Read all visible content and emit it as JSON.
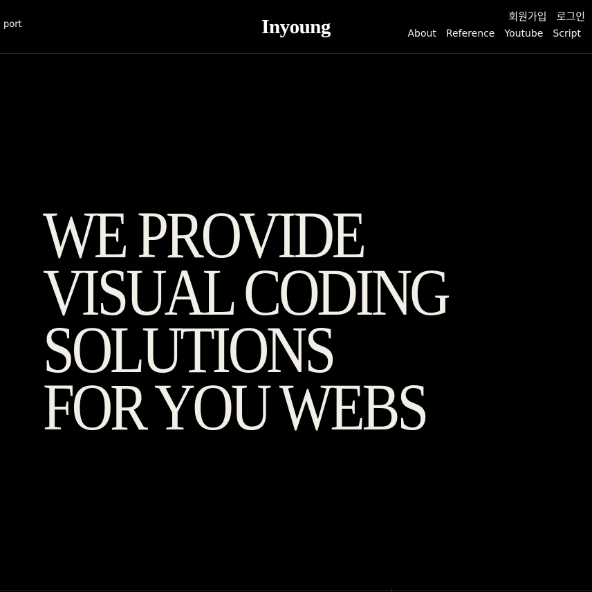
{
  "header": {
    "left_link": "port",
    "logo": "Inyoung",
    "auth": {
      "signup": "회원가입",
      "login": "로그인"
    },
    "nav": {
      "about": "About",
      "reference": "Reference",
      "youtube": "Youtube",
      "script": "Script"
    }
  },
  "hero": {
    "lines": [
      "WE PROVIDE",
      "VISUAL CODING",
      "SOLUTIONS",
      "FOR YOU WEBS"
    ]
  },
  "colors": {
    "background": "#000000",
    "text": "#f2efe9"
  }
}
